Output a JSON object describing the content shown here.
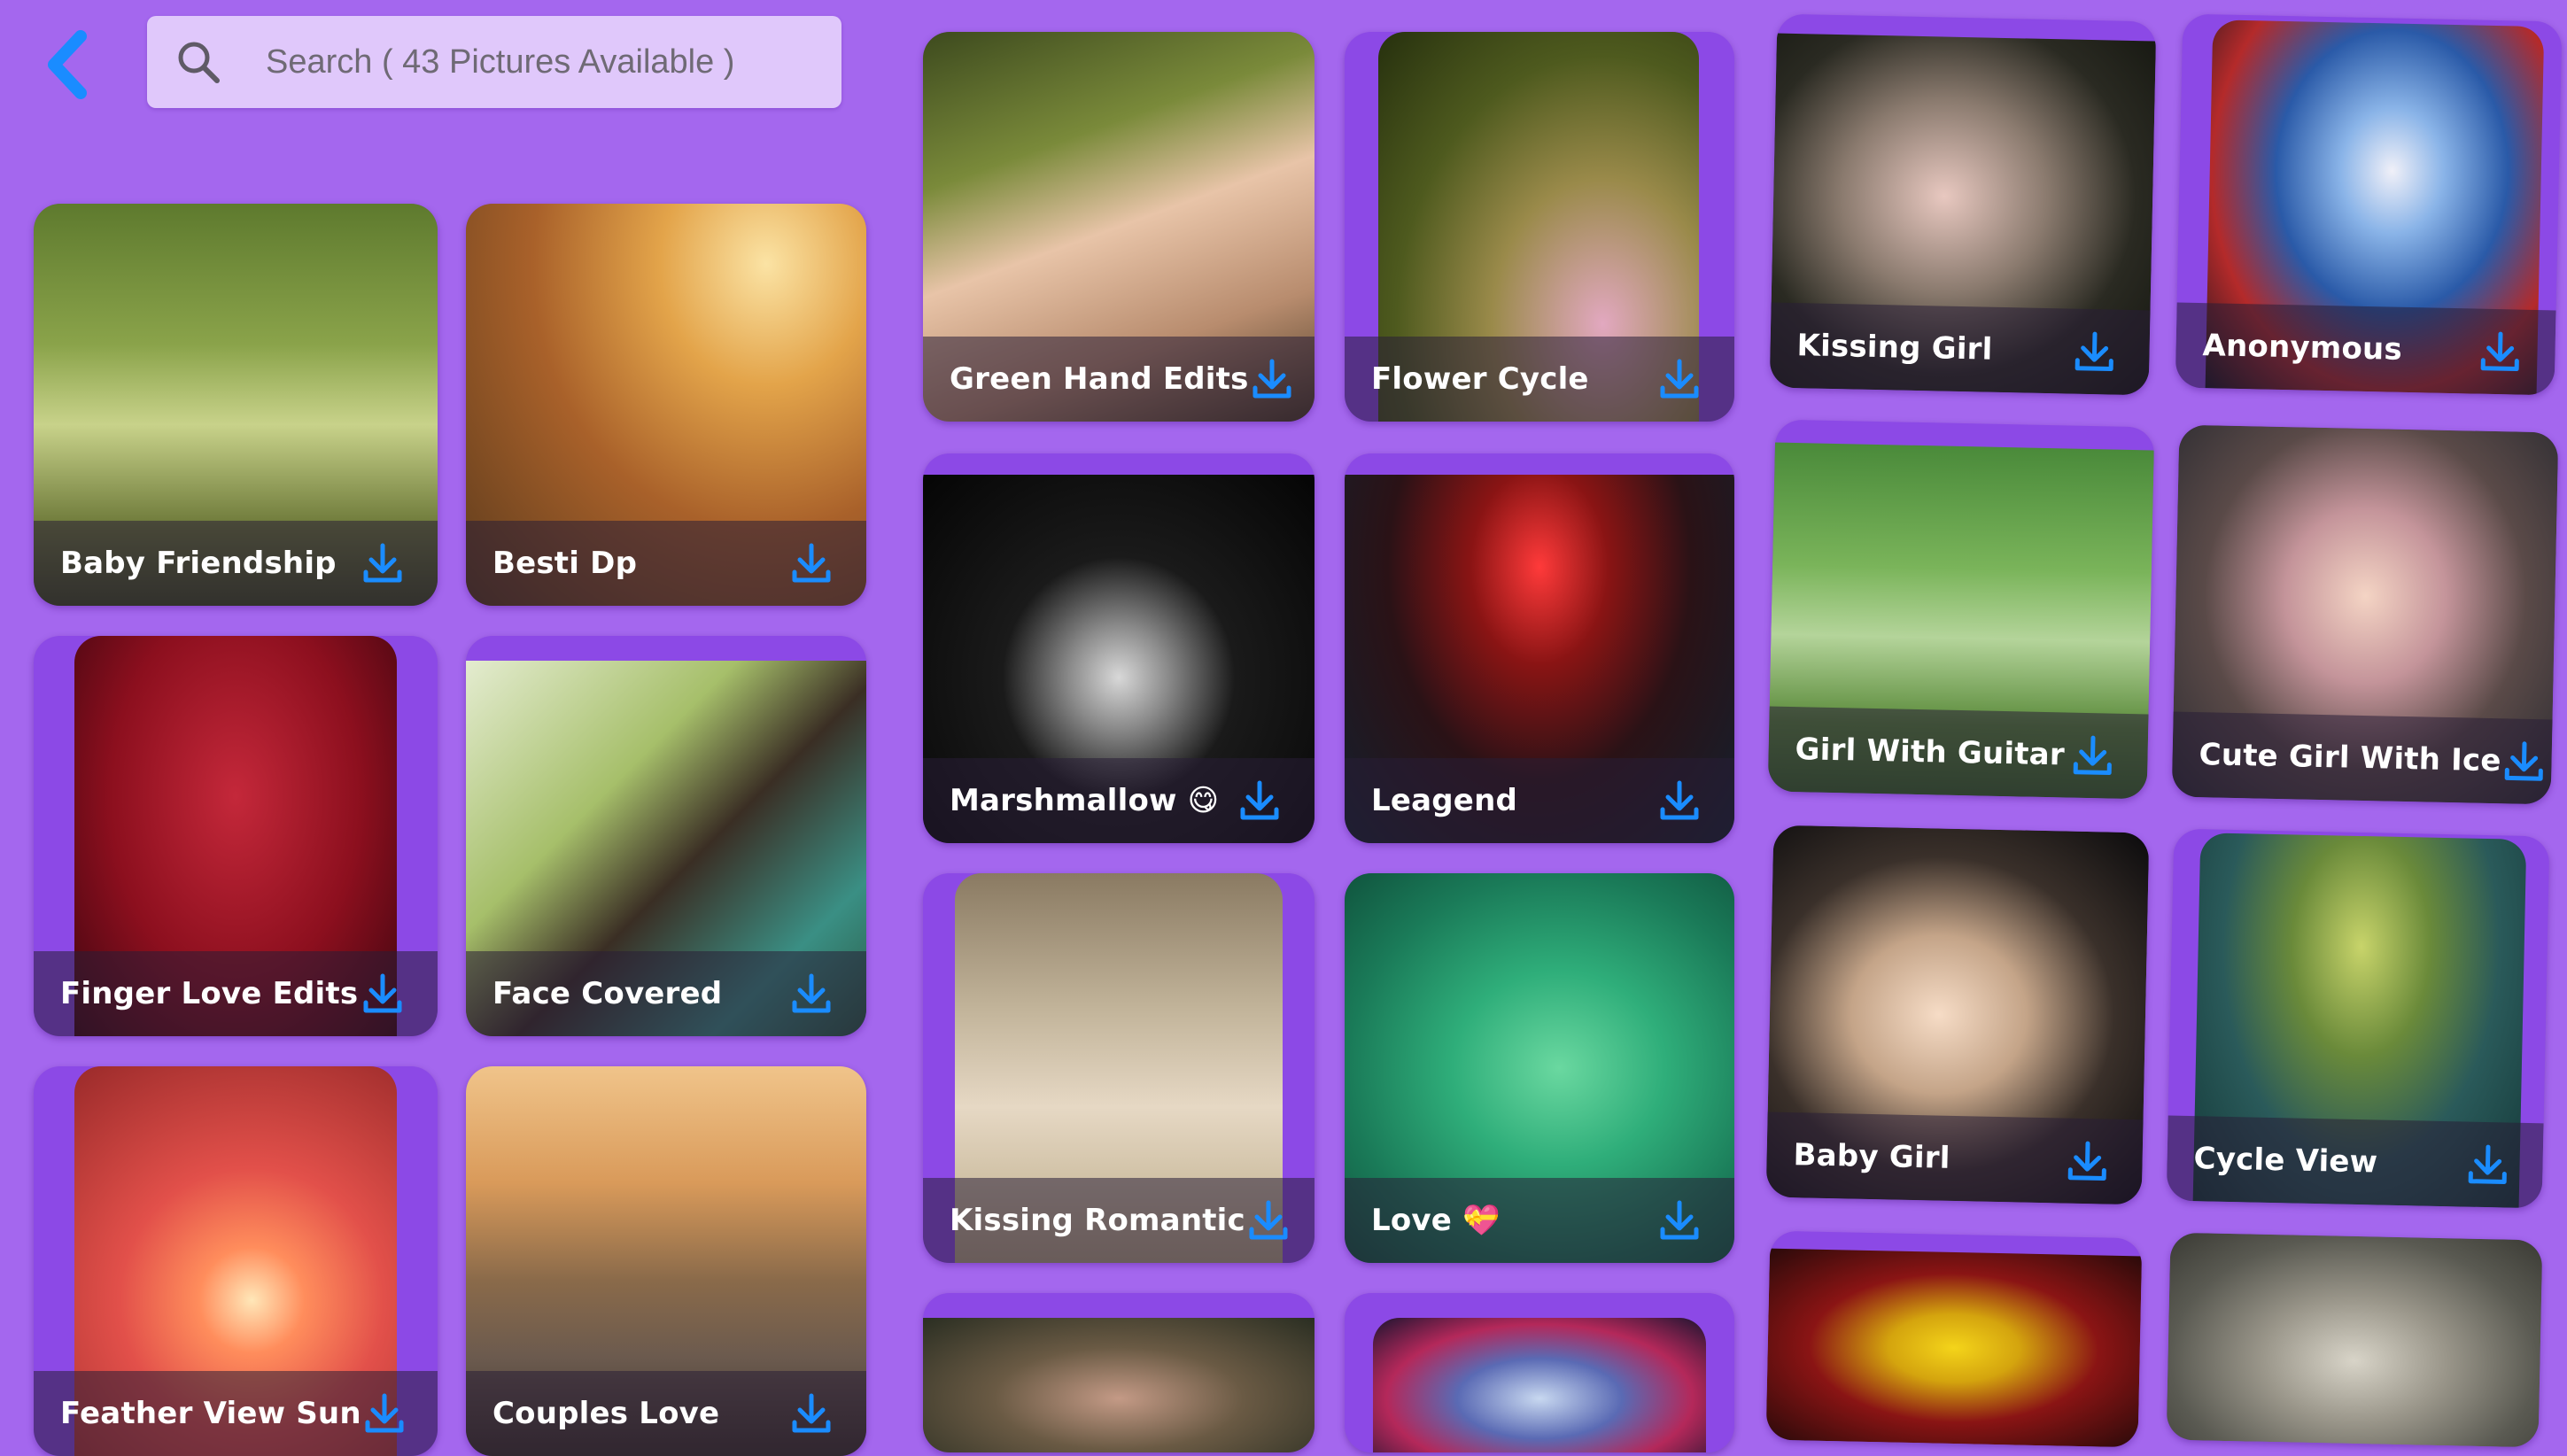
{
  "header": {
    "back_icon": "chevron-left-icon",
    "search_icon": "search-icon",
    "search_placeholder": "Search ( 43 Pictures Available )",
    "search_value": ""
  },
  "colors": {
    "background": "#a467ee",
    "search_field": "#e0c8fb",
    "card_frame": "#8c49e6",
    "accent_blue": "#1a8cff",
    "label_text": "#ffffff"
  },
  "download_icon": "download-icon",
  "pictures": [
    {
      "label": "Baby Friendship"
    },
    {
      "label": "Besti Dp"
    },
    {
      "label": "Finger Love Edits"
    },
    {
      "label": "Face Covered"
    },
    {
      "label": "Feather View Sun"
    },
    {
      "label": "Couples Love"
    },
    {
      "label": "Green Hand Edits"
    },
    {
      "label": "Flower Cycle"
    },
    {
      "label": "Marshmallow 😋"
    },
    {
      "label": "Leagend"
    },
    {
      "label": "Kissing Romantic"
    },
    {
      "label": "Love 💝"
    },
    {
      "label": ""
    },
    {
      "label": ""
    },
    {
      "label": "Kissing Girl"
    },
    {
      "label": "Anonymous"
    },
    {
      "label": "Girl With Guitar"
    },
    {
      "label": "Cute Girl With Ice"
    },
    {
      "label": "Baby Girl"
    },
    {
      "label": "Cycle View"
    },
    {
      "label": ""
    },
    {
      "label": ""
    }
  ]
}
